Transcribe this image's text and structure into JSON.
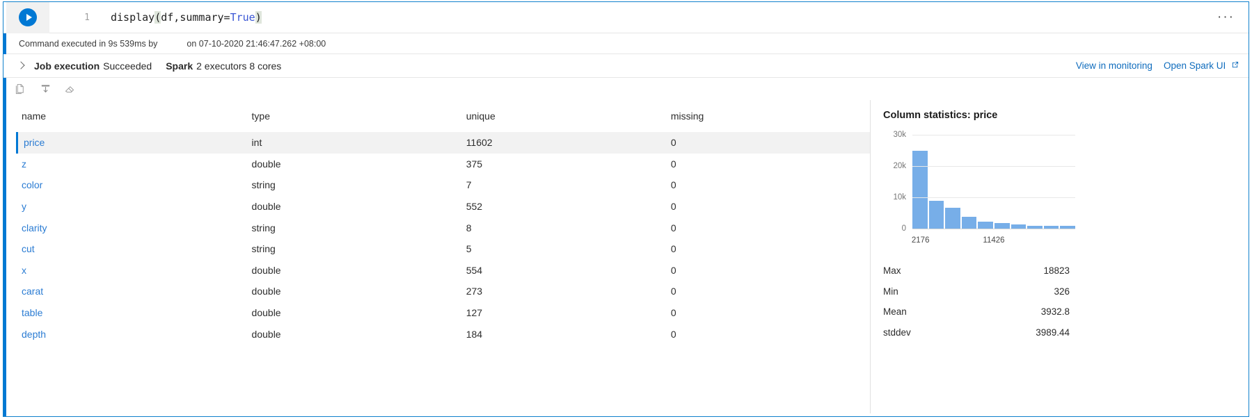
{
  "code_cell": {
    "run_icon": "play-icon",
    "line_number": "1",
    "code_prefix": "display",
    "code_open_paren": "(",
    "code_args": "df,summary=",
    "code_keyword": "True",
    "code_close_paren": ")",
    "more_label": "···"
  },
  "status": {
    "executed_text": "Command executed in 9s 539ms by",
    "timestamp_text": "on 07-10-2020 21:46:47.262 +08:00"
  },
  "job": {
    "chevron_icon": "chevron-right-icon",
    "job_label": "Job execution",
    "job_value": "Succeeded",
    "spark_label": "Spark",
    "spark_value": "2 executors 8 cores",
    "link_monitoring": "View in monitoring",
    "link_spark_ui": "Open Spark UI",
    "external_icon": "external-link-icon"
  },
  "toolbar": {
    "copy_icon": "copy-icon",
    "download_icon": "download-icon",
    "clear_icon": "eraser-icon"
  },
  "table": {
    "columns": [
      "name",
      "type",
      "unique",
      "missing"
    ],
    "rows": [
      {
        "name": "price",
        "type": "int",
        "unique": "11602",
        "missing": "0",
        "selected": true
      },
      {
        "name": "z",
        "type": "double",
        "unique": "375",
        "missing": "0",
        "selected": false
      },
      {
        "name": "color",
        "type": "string",
        "unique": "7",
        "missing": "0",
        "selected": false
      },
      {
        "name": "y",
        "type": "double",
        "unique": "552",
        "missing": "0",
        "selected": false
      },
      {
        "name": "clarity",
        "type": "string",
        "unique": "8",
        "missing": "0",
        "selected": false
      },
      {
        "name": "cut",
        "type": "string",
        "unique": "5",
        "missing": "0",
        "selected": false
      },
      {
        "name": "x",
        "type": "double",
        "unique": "554",
        "missing": "0",
        "selected": false
      },
      {
        "name": "carat",
        "type": "double",
        "unique": "273",
        "missing": "0",
        "selected": false
      },
      {
        "name": "table",
        "type": "double",
        "unique": "127",
        "missing": "0",
        "selected": false
      },
      {
        "name": "depth",
        "type": "double",
        "unique": "184",
        "missing": "0",
        "selected": false
      }
    ]
  },
  "stats_panel": {
    "title": "Column statistics: price",
    "metrics": [
      {
        "key": "Max",
        "value": "18823"
      },
      {
        "key": "Min",
        "value": "326"
      },
      {
        "key": "Mean",
        "value": "3932.8"
      },
      {
        "key": "stddev",
        "value": "3989.44"
      }
    ]
  },
  "chart_data": {
    "type": "bar",
    "title": "Column statistics: price",
    "xlabel": "",
    "ylabel": "",
    "grid": true,
    "legend": "none",
    "bar_color": "#77aee8",
    "ylim": [
      0,
      30000
    ],
    "yticks": [
      0,
      10000,
      20000,
      30000
    ],
    "ytick_labels": [
      "0",
      "10k",
      "20k",
      "30k"
    ],
    "xtick_labels": [
      "2176",
      "11426"
    ],
    "xtick_positions": [
      0,
      4.5
    ],
    "categories": [
      "b1",
      "b2",
      "b3",
      "b4",
      "b5",
      "b6",
      "b7",
      "b8",
      "b9",
      "b10"
    ],
    "values": [
      25000,
      8800,
      6700,
      3800,
      2300,
      1700,
      1300,
      1000,
      800,
      800
    ]
  },
  "colors": {
    "accent": "#0078d4",
    "link": "#0f6cbd",
    "cell_link": "#2b7cd3",
    "bar": "#77aee8",
    "row_selected_bg": "#f2f2f2"
  }
}
